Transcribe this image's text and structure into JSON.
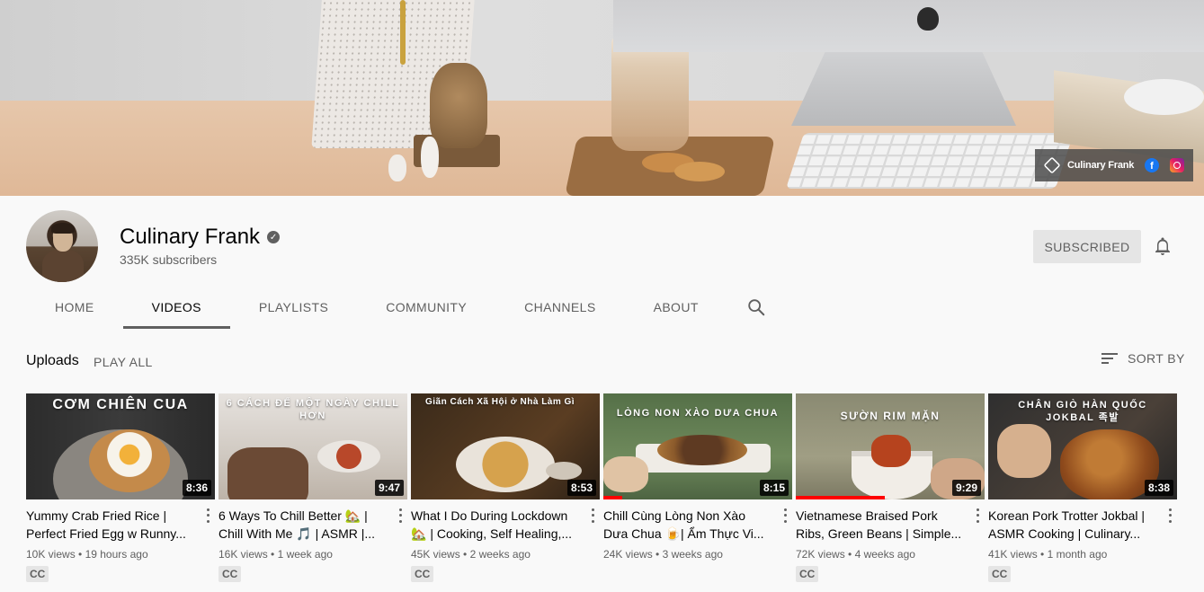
{
  "banner": {
    "social_name": "Culinary Frank",
    "facebook_glyph": "f"
  },
  "channel": {
    "name": "Culinary Frank",
    "verified_glyph": "✓",
    "subscribers": "335K subscribers",
    "subscribe_label": "SUBSCRIBED"
  },
  "tabs": [
    "HOME",
    "VIDEOS",
    "PLAYLISTS",
    "COMMUNITY",
    "CHANNELS",
    "ABOUT"
  ],
  "active_tab": "VIDEOS",
  "section": {
    "title": "Uploads",
    "play_all": "PLAY ALL",
    "sort_by": "SORT BY"
  },
  "colors": {
    "accent_red": "#ff0000",
    "text_primary": "#030303",
    "text_secondary": "#606060"
  },
  "videos": [
    {
      "thumb_text": "CƠM CHIÊN CUA",
      "duration": "8:36",
      "title": "Yummy Crab Fried Rice | Perfect Fried Egg w Runny...",
      "views": "10K views",
      "age": "19 hours ago",
      "badge": "CC",
      "progress": 0
    },
    {
      "thumb_text": "6 CÁCH ĐỂ MỘT NGÀY CHILL HƠN",
      "duration": "9:47",
      "title": "6 Ways To Chill Better 🏡 | Chill With Me 🎵 | ASMR |...",
      "views": "16K views",
      "age": "1 week ago",
      "badge": "CC",
      "progress": 0
    },
    {
      "thumb_text": "Giãn Cách Xã Hội ở Nhà Làm Gì",
      "duration": "8:53",
      "title": "What I Do During Lockdown 🏡 | Cooking, Self Healing,...",
      "views": "45K views",
      "age": "2 weeks ago",
      "badge": "CC",
      "progress": 0
    },
    {
      "thumb_text": "LÒNG NON XÀO DƯA CHUA",
      "duration": "8:15",
      "title": "Chill Cùng Lòng Non Xào Dưa Chua 🍺| Ẩm Thực Vi...",
      "views": "24K views",
      "age": "3 weeks ago",
      "badge": "",
      "progress": 0.1
    },
    {
      "thumb_text": "SƯỜN RIM MẶN",
      "duration": "9:29",
      "title": "Vietnamese Braised Pork Ribs, Green Beans | Simple...",
      "views": "72K views",
      "age": "4 weeks ago",
      "badge": "CC",
      "progress": 0.47
    },
    {
      "thumb_text": "CHÂN GIÒ HÀN QUỐC JOKBAL 족발",
      "duration": "8:38",
      "title": "Korean Pork Trotter Jokbal | ASMR Cooking | Culinary...",
      "views": "41K views",
      "age": "1 month ago",
      "badge": "CC",
      "progress": 0
    }
  ]
}
